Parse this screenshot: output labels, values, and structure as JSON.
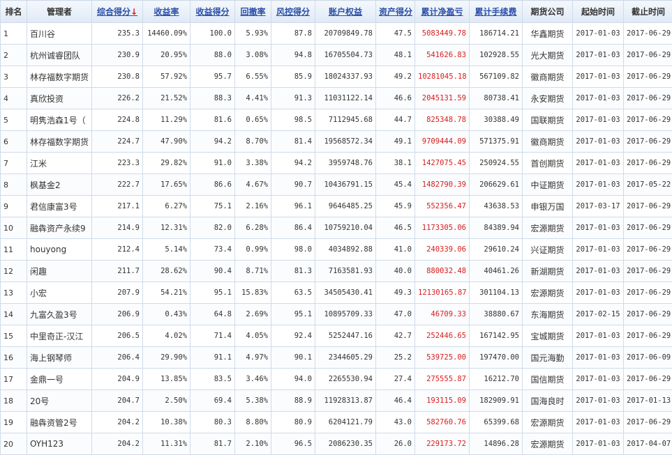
{
  "headers": {
    "rank": "排名",
    "manager": "管理者",
    "composite": "综合得分",
    "composite_sort_arrow": "↓",
    "return_rate": "收益率",
    "return_score": "收益得分",
    "drawdown": "回撤率",
    "risk_score": "风控得分",
    "equity": "账户权益",
    "asset_score": "资产得分",
    "net_pnl": "累计净盈亏",
    "fees": "累计手续费",
    "broker": "期货公司",
    "start": "起始时间",
    "end": "截止时间"
  },
  "rows": [
    {
      "rank": "1",
      "manager": "百川谷",
      "composite": "235.3",
      "return_rate": "14460.09%",
      "return_score": "100.0",
      "drawdown": "5.93%",
      "risk_score": "87.8",
      "equity": "20709849.78",
      "asset_score": "47.5",
      "net_pnl": "5083449.78",
      "fees": "186714.21",
      "broker": "华鑫期货",
      "start": "2017-01-03",
      "end": "2017-06-29"
    },
    {
      "rank": "2",
      "manager": "杭州诚睿团队",
      "composite": "230.9",
      "return_rate": "20.95%",
      "return_score": "88.0",
      "drawdown": "3.08%",
      "risk_score": "94.8",
      "equity": "16705504.73",
      "asset_score": "48.1",
      "net_pnl": "541626.83",
      "fees": "102928.55",
      "broker": "光大期货",
      "start": "2017-01-03",
      "end": "2017-06-29"
    },
    {
      "rank": "3",
      "manager": "林存福数字期货",
      "composite": "230.8",
      "return_rate": "57.92%",
      "return_score": "95.7",
      "drawdown": "6.55%",
      "risk_score": "85.9",
      "equity": "18024337.93",
      "asset_score": "49.2",
      "net_pnl": "10281045.18",
      "fees": "567109.82",
      "broker": "徽商期货",
      "start": "2017-01-03",
      "end": "2017-06-29"
    },
    {
      "rank": "4",
      "manager": "真欣投资",
      "composite": "226.2",
      "return_rate": "21.52%",
      "return_score": "88.3",
      "drawdown": "4.41%",
      "risk_score": "91.3",
      "equity": "11031122.14",
      "asset_score": "46.6",
      "net_pnl": "2045131.59",
      "fees": "80738.41",
      "broker": "永安期货",
      "start": "2017-01-03",
      "end": "2017-06-29"
    },
    {
      "rank": "5",
      "manager": "明隽浩森1号（",
      "composite": "224.8",
      "return_rate": "11.29%",
      "return_score": "81.6",
      "drawdown": "0.65%",
      "risk_score": "98.5",
      "equity": "7112945.68",
      "asset_score": "44.7",
      "net_pnl": "825348.78",
      "fees": "30388.49",
      "broker": "国联期货",
      "start": "2017-01-03",
      "end": "2017-06-29"
    },
    {
      "rank": "6",
      "manager": "林存福数字期货",
      "composite": "224.7",
      "return_rate": "47.90%",
      "return_score": "94.2",
      "drawdown": "8.70%",
      "risk_score": "81.4",
      "equity": "19568572.34",
      "asset_score": "49.1",
      "net_pnl": "9709444.09",
      "fees": "571375.91",
      "broker": "徽商期货",
      "start": "2017-01-03",
      "end": "2017-06-29"
    },
    {
      "rank": "7",
      "manager": "江米",
      "composite": "223.3",
      "return_rate": "29.82%",
      "return_score": "91.0",
      "drawdown": "3.38%",
      "risk_score": "94.2",
      "equity": "3959748.76",
      "asset_score": "38.1",
      "net_pnl": "1427075.45",
      "fees": "250924.55",
      "broker": "首创期货",
      "start": "2017-01-03",
      "end": "2017-06-29"
    },
    {
      "rank": "8",
      "manager": "枫基金2",
      "composite": "222.7",
      "return_rate": "17.65%",
      "return_score": "86.6",
      "drawdown": "4.67%",
      "risk_score": "90.7",
      "equity": "10436791.15",
      "asset_score": "45.4",
      "net_pnl": "1482790.39",
      "fees": "206629.61",
      "broker": "中证期货",
      "start": "2017-01-03",
      "end": "2017-05-22"
    },
    {
      "rank": "9",
      "manager": "君信康富3号",
      "composite": "217.1",
      "return_rate": "6.27%",
      "return_score": "75.1",
      "drawdown": "2.16%",
      "risk_score": "96.1",
      "equity": "9646485.25",
      "asset_score": "45.9",
      "net_pnl": "552356.47",
      "fees": "43638.53",
      "broker": "申银万国",
      "start": "2017-03-17",
      "end": "2017-06-29"
    },
    {
      "rank": "10",
      "manager": "融犇资产永续9",
      "composite": "214.9",
      "return_rate": "12.31%",
      "return_score": "82.0",
      "drawdown": "6.28%",
      "risk_score": "86.4",
      "equity": "10759210.04",
      "asset_score": "46.5",
      "net_pnl": "1173305.06",
      "fees": "84389.94",
      "broker": "宏源期货",
      "start": "2017-01-03",
      "end": "2017-06-29"
    },
    {
      "rank": "11",
      "manager": "houyong",
      "composite": "212.4",
      "return_rate": "5.14%",
      "return_score": "73.4",
      "drawdown": "0.99%",
      "risk_score": "98.0",
      "equity": "4034892.88",
      "asset_score": "41.0",
      "net_pnl": "240339.06",
      "fees": "29610.24",
      "broker": "兴证期货",
      "start": "2017-01-03",
      "end": "2017-06-29"
    },
    {
      "rank": "12",
      "manager": "闲趣",
      "composite": "211.7",
      "return_rate": "28.62%",
      "return_score": "90.4",
      "drawdown": "8.71%",
      "risk_score": "81.3",
      "equity": "7163581.93",
      "asset_score": "40.0",
      "net_pnl": "880032.48",
      "fees": "40461.26",
      "broker": "新湖期货",
      "start": "2017-01-03",
      "end": "2017-06-29"
    },
    {
      "rank": "13",
      "manager": "小宏",
      "composite": "207.9",
      "return_rate": "54.21%",
      "return_score": "95.1",
      "drawdown": "15.83%",
      "risk_score": "63.5",
      "equity": "34505430.41",
      "asset_score": "49.3",
      "net_pnl": "12130165.87",
      "fees": "301104.13",
      "broker": "宏源期货",
      "start": "2017-01-03",
      "end": "2017-06-29"
    },
    {
      "rank": "14",
      "manager": "九富久盈3号",
      "composite": "206.9",
      "return_rate": "0.43%",
      "return_score": "64.8",
      "drawdown": "2.69%",
      "risk_score": "95.1",
      "equity": "10895709.33",
      "asset_score": "47.0",
      "net_pnl": "46709.33",
      "fees": "38880.67",
      "broker": "东海期货",
      "start": "2017-02-15",
      "end": "2017-06-29"
    },
    {
      "rank": "15",
      "manager": "中里奇正-汉江",
      "composite": "206.5",
      "return_rate": "4.02%",
      "return_score": "71.4",
      "drawdown": "4.05%",
      "risk_score": "92.4",
      "equity": "5252447.16",
      "asset_score": "42.7",
      "net_pnl": "252446.65",
      "fees": "167142.95",
      "broker": "宝城期货",
      "start": "2017-01-03",
      "end": "2017-06-29"
    },
    {
      "rank": "16",
      "manager": "海上钢琴师",
      "composite": "206.4",
      "return_rate": "29.90%",
      "return_score": "91.1",
      "drawdown": "4.97%",
      "risk_score": "90.1",
      "equity": "2344605.29",
      "asset_score": "25.2",
      "net_pnl": "539725.00",
      "fees": "197470.00",
      "broker": "国元海勤",
      "start": "2017-01-03",
      "end": "2017-06-09"
    },
    {
      "rank": "17",
      "manager": "金鼎一号",
      "composite": "204.9",
      "return_rate": "13.85%",
      "return_score": "83.5",
      "drawdown": "3.46%",
      "risk_score": "94.0",
      "equity": "2265530.94",
      "asset_score": "27.4",
      "net_pnl": "275555.87",
      "fees": "16212.70",
      "broker": "国信期货",
      "start": "2017-01-03",
      "end": "2017-06-29"
    },
    {
      "rank": "18",
      "manager": "20号",
      "composite": "204.7",
      "return_rate": "2.50%",
      "return_score": "69.4",
      "drawdown": "5.38%",
      "risk_score": "88.9",
      "equity": "11928313.87",
      "asset_score": "46.4",
      "net_pnl": "193115.09",
      "fees": "182909.91",
      "broker": "国海良时",
      "start": "2017-01-03",
      "end": "2017-01-13"
    },
    {
      "rank": "19",
      "manager": "融犇资管2号",
      "composite": "204.2",
      "return_rate": "10.38%",
      "return_score": "80.3",
      "drawdown": "8.80%",
      "risk_score": "80.9",
      "equity": "6204121.79",
      "asset_score": "43.0",
      "net_pnl": "582760.76",
      "fees": "65399.68",
      "broker": "宏源期货",
      "start": "2017-01-03",
      "end": "2017-06-29"
    },
    {
      "rank": "20",
      "manager": "OYH123",
      "composite": "204.2",
      "return_rate": "11.31%",
      "return_score": "81.7",
      "drawdown": "2.10%",
      "risk_score": "96.5",
      "equity": "2086230.35",
      "asset_score": "26.0",
      "net_pnl": "229173.72",
      "fees": "14896.28",
      "broker": "宏源期货",
      "start": "2017-01-03",
      "end": "2017-04-07"
    }
  ],
  "colors": {
    "header_link": "#2b4fa8",
    "pnl_red": "#d81c1c",
    "border": "#cfdbe9"
  }
}
